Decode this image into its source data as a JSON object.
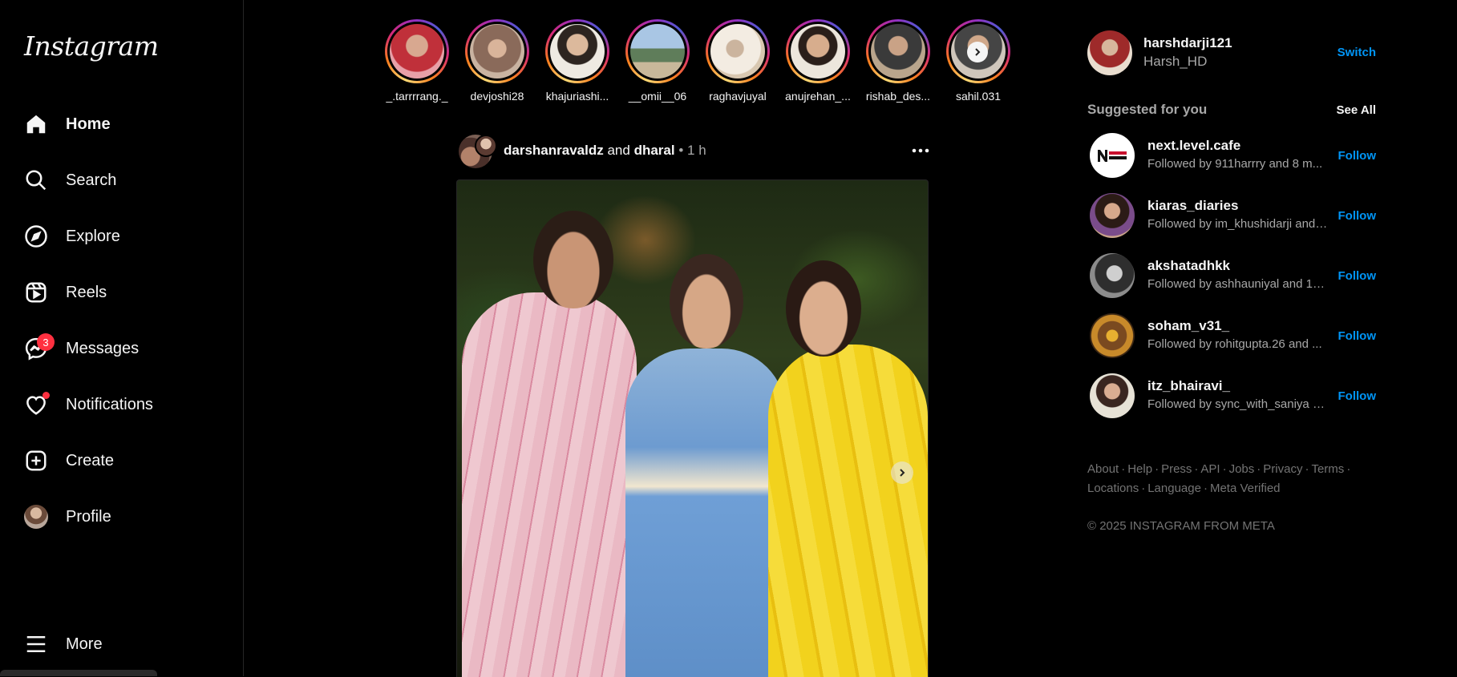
{
  "app": {
    "logo": "Instagram"
  },
  "sidebar": {
    "items": [
      {
        "label": "Home",
        "icon": "home-icon"
      },
      {
        "label": "Search",
        "icon": "search-icon"
      },
      {
        "label": "Explore",
        "icon": "compass-icon"
      },
      {
        "label": "Reels",
        "icon": "reels-icon"
      },
      {
        "label": "Messages",
        "icon": "messenger-icon",
        "badge": "3"
      },
      {
        "label": "Notifications",
        "icon": "heart-icon"
      },
      {
        "label": "Create",
        "icon": "plus-square-icon"
      },
      {
        "label": "Profile",
        "icon": "avatar"
      }
    ],
    "more": "More"
  },
  "stories": [
    {
      "name": "_.tarrrrang._"
    },
    {
      "name": "devjoshi28"
    },
    {
      "name": "khajuriashi..."
    },
    {
      "name": "__omii__06"
    },
    {
      "name": "raghavjuyal"
    },
    {
      "name": "anujrehan_..."
    },
    {
      "name": "rishab_des..."
    },
    {
      "name": "sahil.031"
    }
  ],
  "post": {
    "author1": "darshanravaldz",
    "joiner": "and",
    "author2": "dharal",
    "time": "1 h"
  },
  "right": {
    "username": "harshdarji121",
    "full_name": "Harsh_HD",
    "switch": "Switch",
    "suggested_title": "Suggested for you",
    "see_all": "See All",
    "suggestions": [
      {
        "user": "next.level.cafe",
        "sub": "Followed by 911harrry and 8 m...",
        "action": "Follow"
      },
      {
        "user": "kiaras_diaries",
        "sub": "Followed by im_khushidarji and ...",
        "action": "Follow"
      },
      {
        "user": "akshatadhkk",
        "sub": "Followed by ashhauniyal and 13...",
        "action": "Follow"
      },
      {
        "user": "soham_v31_",
        "sub": "Followed by rohitgupta.26 and ...",
        "action": "Follow"
      },
      {
        "user": "itz_bhairavi_",
        "sub": "Followed by sync_with_saniya a...",
        "action": "Follow"
      }
    ],
    "footer_links": [
      "About",
      "Help",
      "Press",
      "API",
      "Jobs",
      "Privacy",
      "Terms",
      "Locations",
      "Language",
      "Meta Verified"
    ],
    "copyright": "© 2025 INSTAGRAM FROM META"
  },
  "colors": {
    "accent": "#0095f6",
    "badge": "#ff3040",
    "background": "#000000"
  }
}
